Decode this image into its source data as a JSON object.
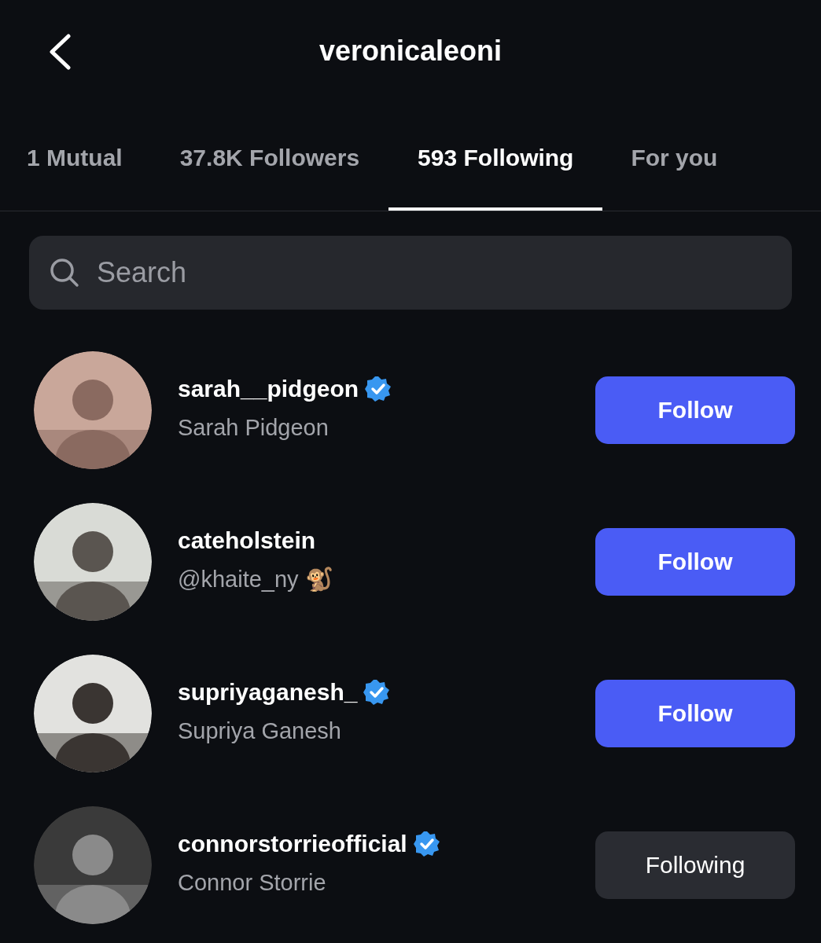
{
  "header": {
    "title": "veronicaleoni"
  },
  "tabs": [
    {
      "label": "1 Mutual",
      "selected": false
    },
    {
      "label": "37.8K Followers",
      "selected": false
    },
    {
      "label": "593 Following",
      "selected": true
    },
    {
      "label": "For you",
      "selected": false
    }
  ],
  "search": {
    "placeholder": "Search"
  },
  "accounts": [
    {
      "username": "sarah__pidgeon",
      "verified": true,
      "subtitle": "Sarah Pidgeon",
      "button": "Follow",
      "following": false
    },
    {
      "username": "cateholstein",
      "verified": false,
      "subtitle": "@khaite_ny 🐒",
      "button": "Follow",
      "following": false
    },
    {
      "username": "supriyaganesh_",
      "verified": true,
      "subtitle": "Supriya Ganesh",
      "button": "Follow",
      "following": false
    },
    {
      "username": "connorstorrieofficial",
      "verified": true,
      "subtitle": "Connor Storrie",
      "button": "Following",
      "following": true
    }
  ]
}
